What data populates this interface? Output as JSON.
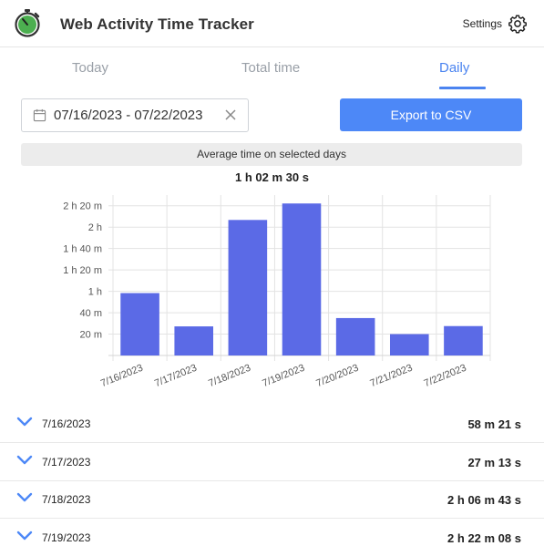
{
  "header": {
    "title": "Web Activity Time Tracker",
    "settings_label": "Settings",
    "logo_icon": "stopwatch-icon",
    "settings_icon": "gear-icon"
  },
  "tabs": [
    {
      "label": "Today",
      "active": false
    },
    {
      "label": "Total time",
      "active": false
    },
    {
      "label": "Daily",
      "active": true
    }
  ],
  "date_range": {
    "value": "07/16/2023 - 07/22/2023",
    "calendar_icon": "calendar-icon",
    "clear_icon": "close-icon"
  },
  "export_label": "Export to CSV",
  "average": {
    "label": "Average time on selected days",
    "value": "1 h 02 m 30 s"
  },
  "colors": {
    "accent": "#4d88f7",
    "bar": "#5b6ae6",
    "logo_green": "#4caf50"
  },
  "chart_data": {
    "type": "bar",
    "categories": [
      "7/16/2023",
      "7/17/2023",
      "7/18/2023",
      "7/19/2023",
      "7/20/2023",
      "7/21/2023",
      "7/22/2023"
    ],
    "values": [
      58.35,
      27.22,
      126.72,
      142.13,
      35,
      20,
      27.5
    ],
    "unit": "minutes",
    "ylim": [
      0,
      150
    ],
    "yticks": [
      {
        "value": 20,
        "label": "20 m"
      },
      {
        "value": 40,
        "label": "40 m"
      },
      {
        "value": 60,
        "label": "1 h"
      },
      {
        "value": 80,
        "label": "1 h 20 m"
      },
      {
        "value": 100,
        "label": "1 h 40 m"
      },
      {
        "value": 120,
        "label": "2 h"
      },
      {
        "value": 140,
        "label": "2 h 20 m"
      }
    ],
    "grid": true,
    "legend": false
  },
  "days": [
    {
      "date": "7/16/2023",
      "time": "58 m 21 s"
    },
    {
      "date": "7/17/2023",
      "time": "27 m 13 s"
    },
    {
      "date": "7/18/2023",
      "time": "2 h 06 m 43 s"
    },
    {
      "date": "7/19/2023",
      "time": "2 h 22 m 08 s"
    }
  ]
}
